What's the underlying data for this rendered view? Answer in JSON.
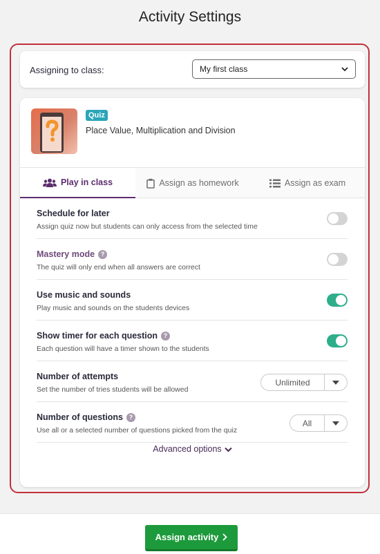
{
  "header": {
    "title": "Activity Settings"
  },
  "class_picker": {
    "label": "Assigning to class:",
    "selected": "My first class"
  },
  "activity": {
    "badge": "Quiz",
    "title": "Place Value, Multiplication and Division",
    "thumbnail_icon": "question-mark-phone"
  },
  "tabs": [
    {
      "label": "Play in class",
      "icon": "users-icon",
      "active": true
    },
    {
      "label": "Assign as homework",
      "icon": "clipboard-icon",
      "active": false
    },
    {
      "label": "Assign as exam",
      "icon": "list-icon",
      "active": false
    }
  ],
  "settings": [
    {
      "title": "Schedule for later",
      "description": "Assign quiz now but students can only access from the selected time",
      "control": "toggle",
      "enabled": false,
      "help": false
    },
    {
      "title": "Mastery mode",
      "description": "The quiz will only end when all answers are correct",
      "control": "toggle",
      "enabled": false,
      "help": true
    },
    {
      "title": "Use music and sounds",
      "description": "Play music and sounds on the students devices",
      "control": "toggle",
      "enabled": true,
      "help": false
    },
    {
      "title": "Show timer for each question",
      "description": "Each question will have a timer shown to the students",
      "control": "toggle",
      "enabled": true,
      "help": true
    },
    {
      "title": "Number of attempts",
      "description": "Set the number of tries students will be allowed",
      "control": "dropdown",
      "value": "Unlimited",
      "help": false
    },
    {
      "title": "Number of questions",
      "description": "Use all or a selected number of questions picked from the quiz",
      "control": "dropdown",
      "value": "All",
      "help": true
    }
  ],
  "help_glyph": "?",
  "advanced_label": "Advanced options",
  "footer": {
    "assign_label": "Assign activity"
  },
  "colors": {
    "accent_purple": "#5c2d6e",
    "toggle_on": "#2eae8a",
    "toggle_off": "#d4d4d4",
    "assign_green": "#1d9a3b",
    "frame_red": "#c0303a",
    "quiz_badge": "#2ba5b8"
  }
}
